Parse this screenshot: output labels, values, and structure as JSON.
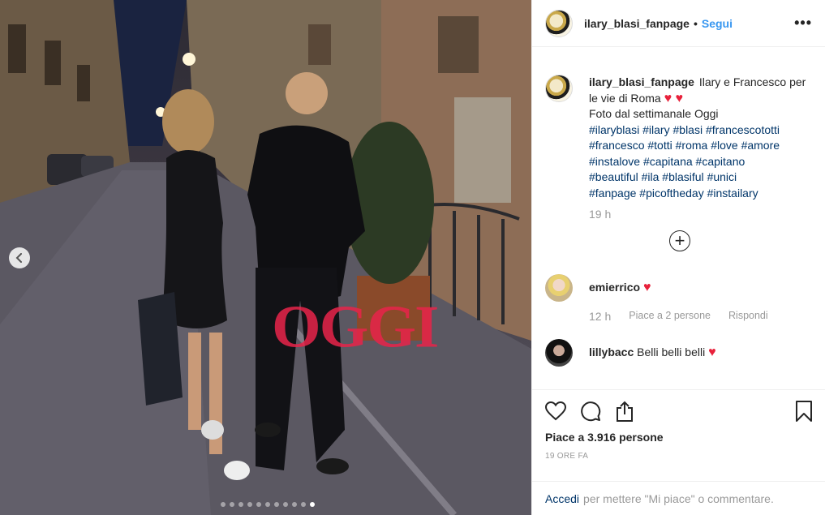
{
  "photo": {
    "watermark": "OGGI",
    "carousel_dot_count": 11,
    "carousel_active_index": 10
  },
  "header": {
    "username": "ilary_blasi_fanpage",
    "separator": "•",
    "follow_label": "Segui",
    "more_label": "•••"
  },
  "caption": {
    "username": "ilary_blasi_fanpage",
    "line1": "Ilary e Francesco per le vie di Roma",
    "hearts": "♥ ♥",
    "line2": "Foto dal settimanale Oggi",
    "hashtags": [
      "#ilaryblasi",
      "#ilary",
      "#blasi",
      "#francescototti",
      "#francesco",
      "#totti",
      "#roma",
      "#love",
      "#amore",
      "#instalove",
      "#capitana",
      "#capitano",
      "#beautiful",
      "#ila",
      "#blasiful",
      "#unici",
      "#fanpage",
      "#picoftheday",
      "#instailary"
    ],
    "time": "19 h"
  },
  "comments": [
    {
      "username": "emierrico",
      "text": "",
      "heart": "♥",
      "time": "12 h",
      "likes": "Piace a 2 persone",
      "reply": "Rispondi"
    },
    {
      "username": "lillybacc",
      "text": "Belli belli belli",
      "heart": "♥"
    }
  ],
  "footer": {
    "likes_text": "Piace a 3.916 persone",
    "posted": "19 ore fa",
    "login_link": "Accedi",
    "login_text": "per mettere \"Mi piace\" o commentare."
  },
  "icons": [
    "chevron-left-icon",
    "heart-icon",
    "comment-icon",
    "share-icon",
    "bookmark-icon",
    "plus-circle-icon"
  ],
  "colors": {
    "link": "#3897f0",
    "hashtag": "#003569",
    "heart": "#e8213b",
    "watermark": "#e8244a"
  }
}
